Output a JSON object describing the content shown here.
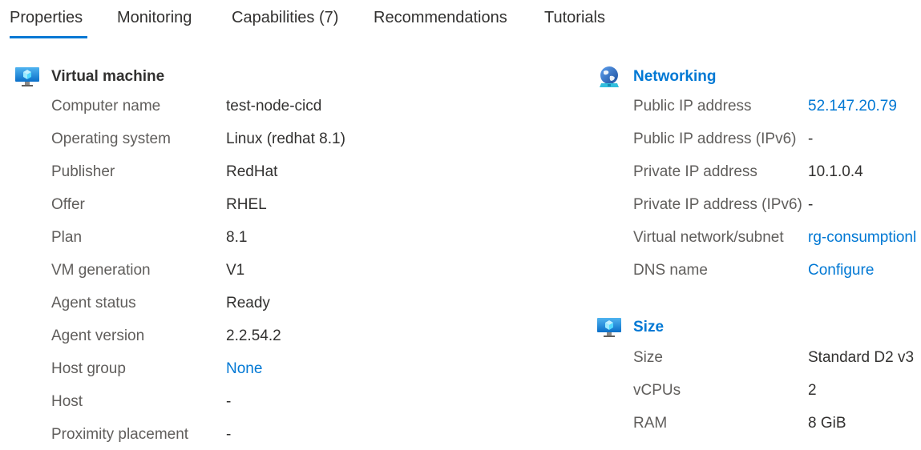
{
  "tabs": [
    {
      "label": "Properties",
      "active": true
    },
    {
      "label": "Monitoring"
    },
    {
      "label": "Capabilities (7)"
    },
    {
      "label": "Recommendations"
    },
    {
      "label": "Tutorials"
    }
  ],
  "virtual_machine": {
    "title": "Virtual machine",
    "icon": "vm-monitor-icon",
    "rows": [
      {
        "label": "Computer name",
        "value": "test-node-cicd"
      },
      {
        "label": "Operating system",
        "value": "Linux (redhat 8.1)"
      },
      {
        "label": "Publisher",
        "value": "RedHat"
      },
      {
        "label": "Offer",
        "value": "RHEL"
      },
      {
        "label": "Plan",
        "value": "8.1"
      },
      {
        "label": "VM generation",
        "value": "V1"
      },
      {
        "label": "Agent status",
        "value": "Ready"
      },
      {
        "label": "Agent version",
        "value": "2.2.54.2"
      },
      {
        "label": "Host group",
        "value": "None",
        "link": true
      },
      {
        "label": "Host",
        "value": "-"
      },
      {
        "label": "Proximity placement",
        "value": "-"
      }
    ]
  },
  "networking": {
    "title": "Networking",
    "icon": "networking-globe-icon",
    "rows": [
      {
        "label": "Public IP address",
        "value": "52.147.20.79",
        "link": true
      },
      {
        "label": "Public IP address (IPv6)",
        "value": "-"
      },
      {
        "label": "Private IP address",
        "value": "10.1.0.4"
      },
      {
        "label": "Private IP address (IPv6)",
        "value": "-"
      },
      {
        "label": "Virtual network/subnet",
        "value": "rg-consumptionl",
        "link": true
      },
      {
        "label": "DNS name",
        "value": "Configure",
        "link": true
      }
    ]
  },
  "size": {
    "title": "Size",
    "icon": "size-monitor-icon",
    "rows": [
      {
        "label": "Size",
        "value": "Standard D2 v3"
      },
      {
        "label": "vCPUs",
        "value": "2"
      },
      {
        "label": "RAM",
        "value": "8 GiB"
      }
    ]
  },
  "colors": {
    "accent": "#0078d4",
    "text": "#323130",
    "label": "#605e5c"
  }
}
